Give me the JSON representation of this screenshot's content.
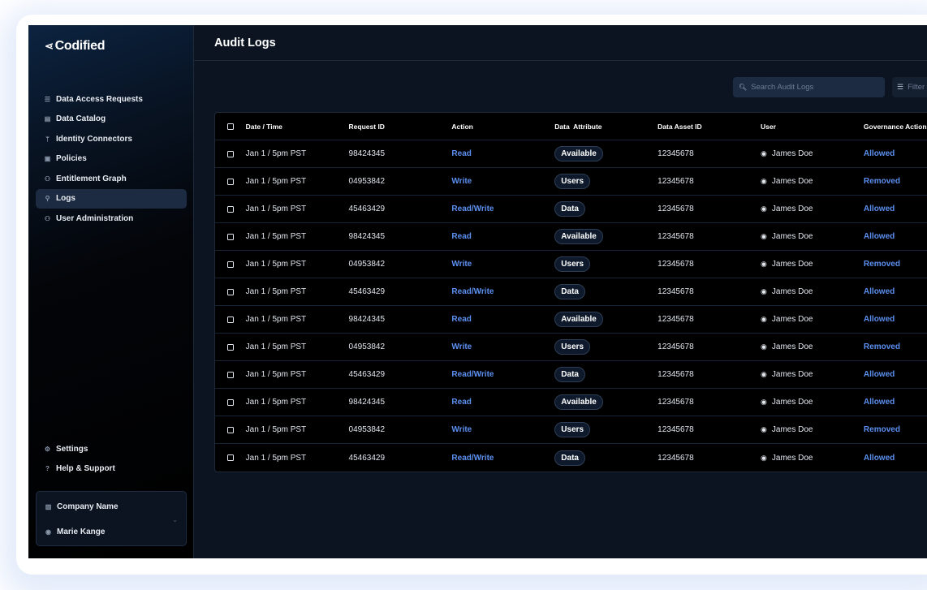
{
  "brand": {
    "name": "Codified",
    "logo_icon": "chevron-arrow-icon"
  },
  "sidebar": {
    "items": [
      {
        "label": "Data Access Requests",
        "icon": "☰",
        "active": false
      },
      {
        "label": "Data Catalog",
        "icon": "▤",
        "active": false
      },
      {
        "label": "Identity Connectors",
        "icon": "ᛘ",
        "active": false
      },
      {
        "label": "Policies",
        "icon": "▣",
        "active": false
      },
      {
        "label": "Entitlement Graph",
        "icon": "⚇",
        "active": false
      },
      {
        "label": "Logs",
        "icon": "⚲",
        "active": true
      },
      {
        "label": "User Administration",
        "icon": "⚇",
        "active": false
      }
    ],
    "bottom_items": [
      {
        "label": "Settings",
        "icon": "⚙"
      },
      {
        "label": "Help & Support",
        "icon": "?"
      }
    ],
    "account": {
      "company": "Company Name",
      "user": "Marie Kange"
    }
  },
  "header": {
    "title": "Audit Logs"
  },
  "toolbar": {
    "search_placeholder": "Search Audit Logs",
    "filter_label": "Filter"
  },
  "table": {
    "columns": [
      "Date / Time",
      "Request ID",
      "Action",
      "Data  Attribute",
      "Data Asset ID",
      "User",
      "Governance Action"
    ],
    "rows": [
      {
        "date": "Jan 1 / 5pm PST",
        "request_id": "98424345",
        "action": "Read",
        "attribute": "Available",
        "asset_id": "12345678",
        "user": "James Doe",
        "governance": "Allowed"
      },
      {
        "date": "Jan 1 / 5pm PST",
        "request_id": "04953842",
        "action": "Write",
        "attribute": "Users",
        "asset_id": "12345678",
        "user": "James Doe",
        "governance": "Removed"
      },
      {
        "date": "Jan 1 / 5pm PST",
        "request_id": "45463429",
        "action": "Read/Write",
        "attribute": "Data",
        "asset_id": "12345678",
        "user": "James Doe",
        "governance": "Allowed"
      },
      {
        "date": "Jan 1 / 5pm PST",
        "request_id": "98424345",
        "action": "Read",
        "attribute": "Available",
        "asset_id": "12345678",
        "user": "James Doe",
        "governance": "Allowed"
      },
      {
        "date": "Jan 1 / 5pm PST",
        "request_id": "04953842",
        "action": "Write",
        "attribute": "Users",
        "asset_id": "12345678",
        "user": "James Doe",
        "governance": "Removed"
      },
      {
        "date": "Jan 1 / 5pm PST",
        "request_id": "45463429",
        "action": "Read/Write",
        "attribute": "Data",
        "asset_id": "12345678",
        "user": "James Doe",
        "governance": "Allowed"
      },
      {
        "date": "Jan 1 / 5pm PST",
        "request_id": "98424345",
        "action": "Read",
        "attribute": "Available",
        "asset_id": "12345678",
        "user": "James Doe",
        "governance": "Allowed"
      },
      {
        "date": "Jan 1 / 5pm PST",
        "request_id": "04953842",
        "action": "Write",
        "attribute": "Users",
        "asset_id": "12345678",
        "user": "James Doe",
        "governance": "Removed"
      },
      {
        "date": "Jan 1 / 5pm PST",
        "request_id": "45463429",
        "action": "Read/Write",
        "attribute": "Data",
        "asset_id": "12345678",
        "user": "James Doe",
        "governance": "Allowed"
      },
      {
        "date": "Jan 1 / 5pm PST",
        "request_id": "98424345",
        "action": "Read",
        "attribute": "Available",
        "asset_id": "12345678",
        "user": "James Doe",
        "governance": "Allowed"
      },
      {
        "date": "Jan 1 / 5pm PST",
        "request_id": "04953842",
        "action": "Write",
        "attribute": "Users",
        "asset_id": "12345678",
        "user": "James Doe",
        "governance": "Removed"
      },
      {
        "date": "Jan 1 / 5pm PST",
        "request_id": "45463429",
        "action": "Read/Write",
        "attribute": "Data",
        "asset_id": "12345678",
        "user": "James Doe",
        "governance": "Allowed"
      }
    ]
  },
  "colors": {
    "accent": "#5b8ff0",
    "active_nav": "#1c2b42",
    "background": "#0b1420"
  }
}
